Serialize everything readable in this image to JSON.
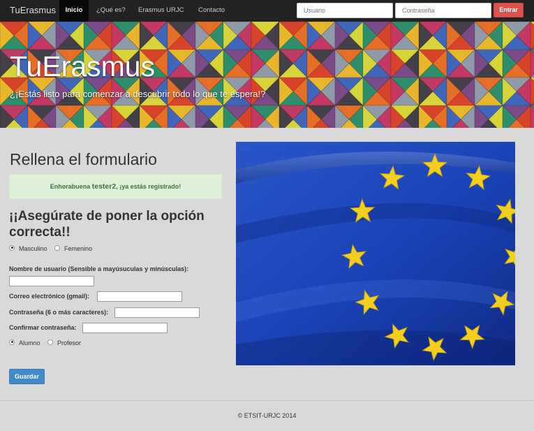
{
  "navbar": {
    "brand": "TuErasmus",
    "items": [
      {
        "label": "Inicio",
        "active": true
      },
      {
        "label": "¿Qué es?",
        "active": false
      },
      {
        "label": "Erasmus URJC",
        "active": false
      },
      {
        "label": "Contacto",
        "active": false
      }
    ],
    "login": {
      "username_placeholder": "Usuario",
      "password_placeholder": "Contraseña",
      "submit_label": "Entrar"
    }
  },
  "hero": {
    "title": "TuErasmus",
    "subtitle": "¿¡Estás listo para comenzar a descubrir todo lo que te espera!?"
  },
  "form": {
    "title": "Rellena el formulario",
    "alert": {
      "prefix": "Enhorabuena ",
      "username": "tester2",
      "suffix": ", ¡ya estás registrado!"
    },
    "warning": "¡¡Asegúrate de poner la opción correcta!!",
    "gender_options": [
      {
        "label": "Masculino",
        "checked": true
      },
      {
        "label": "Femenino",
        "checked": false
      }
    ],
    "fields": {
      "username_label": "Nombre de usuario (Sensible a mayúsuculas y minúsculas):",
      "email_label": "Correo electrónico (gmail):",
      "password_label": "Contraseña (6 o más caracteres):",
      "confirm_label": "Confirmar contraseña:",
      "username_value": "",
      "email_value": "",
      "password_value": "",
      "confirm_value": ""
    },
    "role_options": [
      {
        "label": "Alumno",
        "checked": true
      },
      {
        "label": "Profesor",
        "checked": false
      }
    ],
    "submit_label": "Guardar"
  },
  "footer": {
    "copyright": "© ETSIT-URJC 2014"
  },
  "colors": {
    "navbar_bg": "#222222",
    "page_bg": "#d9d9d9",
    "alert_bg": "#dff0d8",
    "alert_text": "#3c763d",
    "danger": "#d9534f",
    "primary": "#428bca",
    "flag_blue": "#1c44b8",
    "flag_star": "#f2cf1d"
  },
  "images": {
    "hero_pattern": "colorful-triangle-quilt-pattern",
    "flag": "european-union-flag"
  }
}
